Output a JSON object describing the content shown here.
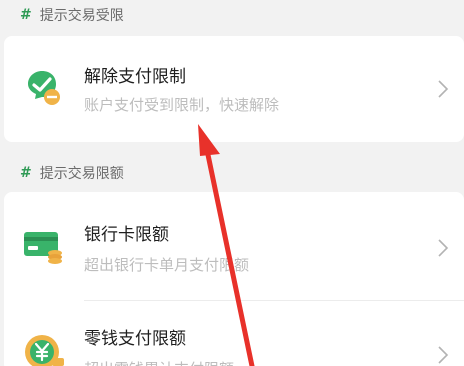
{
  "section1": {
    "header": "提示交易受限",
    "hash": "#",
    "item": {
      "title": "解除支付限制",
      "subtitle": "账户支付受到限制，快速解除",
      "icon": "chat-bubble-restricted-icon"
    }
  },
  "section2": {
    "header": "提示交易限额",
    "hash": "#",
    "items": [
      {
        "title": "银行卡限额",
        "subtitle": "超出银行卡单月支付限额",
        "icon": "bank-card-icon"
      },
      {
        "title": "零钱支付限额",
        "subtitle": "超出零钱累计支付限额",
        "icon": "yuan-coin-icon"
      }
    ]
  },
  "colors": {
    "accent_green": "#2f9a55",
    "icon_green": "#39b36a",
    "coin_orange": "#f0b348",
    "arrow_red": "#e8312a",
    "background": "#f2f2f2"
  }
}
